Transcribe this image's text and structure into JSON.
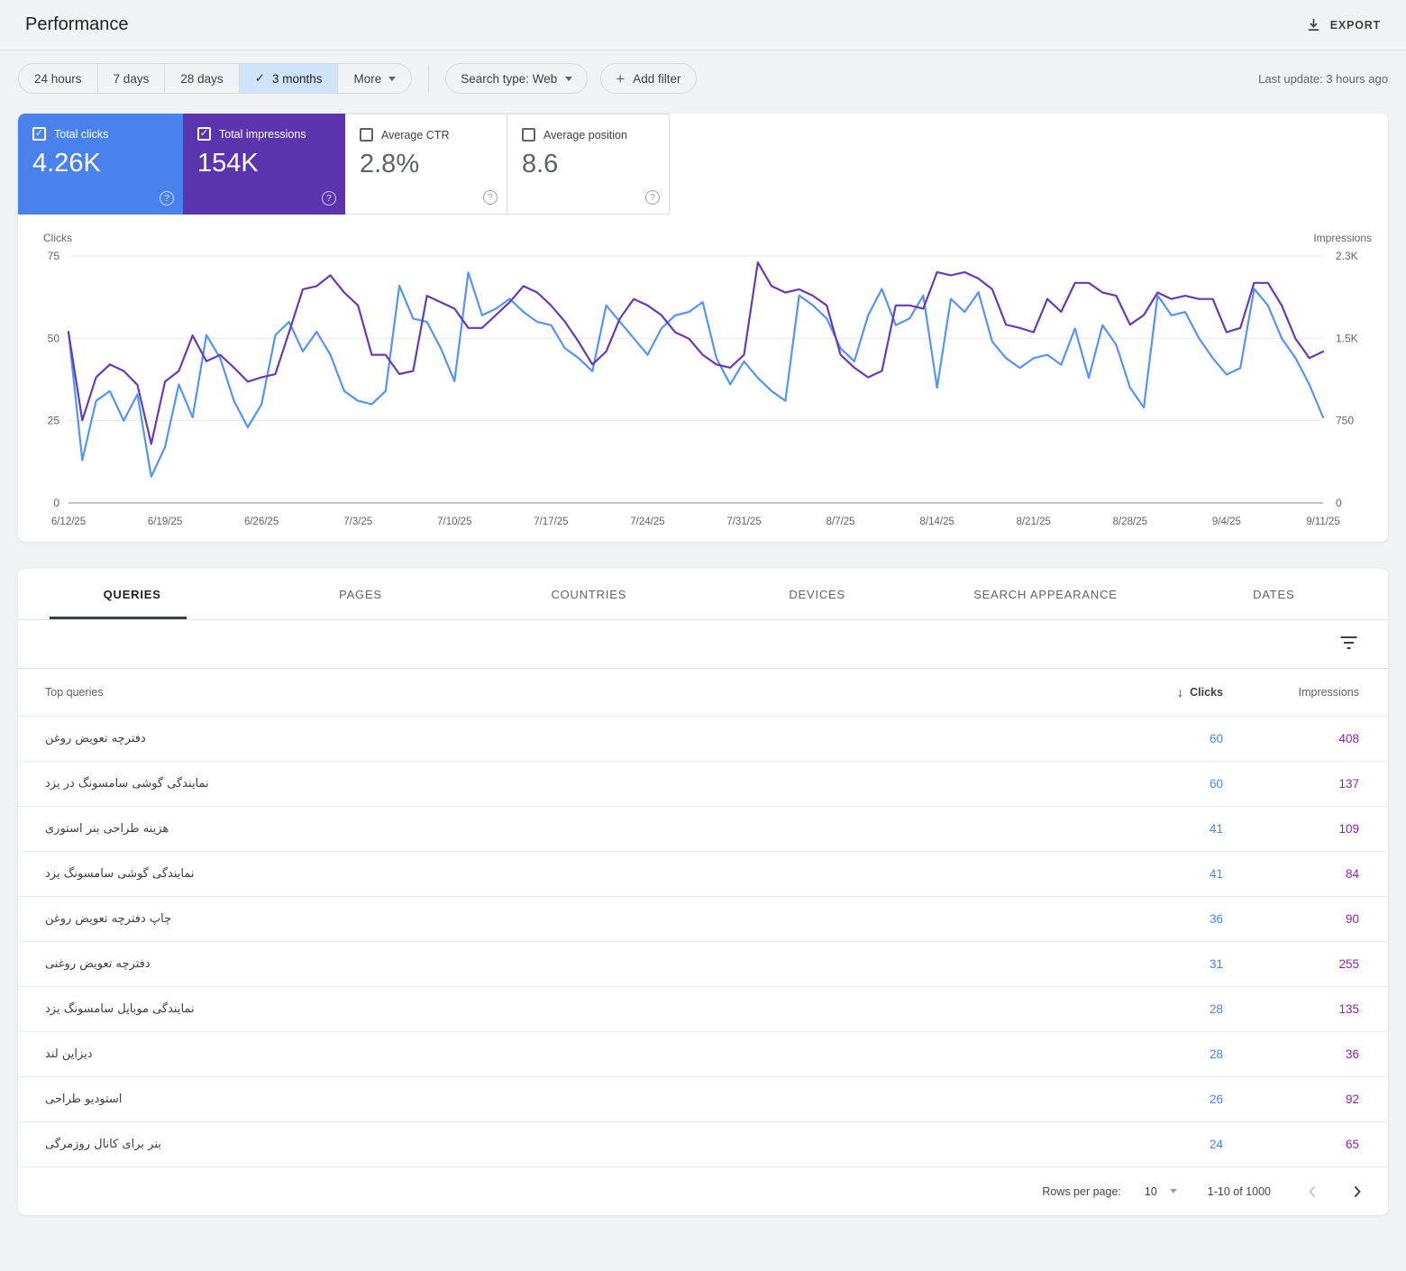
{
  "header": {
    "title": "Performance",
    "export_label": "EXPORT"
  },
  "filters": {
    "ranges": [
      {
        "label": "24 hours",
        "selected": false
      },
      {
        "label": "7 days",
        "selected": false
      },
      {
        "label": "28 days",
        "selected": false
      },
      {
        "label": "3 months",
        "selected": true
      },
      {
        "label": "More",
        "selected": false
      }
    ],
    "search_type_label": "Search type: Web",
    "add_filter_label": "Add filter",
    "last_update": "Last update: 3 hours ago"
  },
  "metrics": [
    {
      "label": "Total clicks",
      "value": "4.26K",
      "checked": true,
      "color": "#4a82ed"
    },
    {
      "label": "Total impressions",
      "value": "154K",
      "checked": true,
      "color": "#5b35b0"
    },
    {
      "label": "Average CTR",
      "value": "2.8%",
      "checked": false,
      "color": "#ffffff"
    },
    {
      "label": "Average position",
      "value": "8.6",
      "checked": false,
      "color": "#ffffff"
    }
  ],
  "chart_data": {
    "type": "line",
    "title": "",
    "grid": true,
    "legend_position": "none",
    "num_points": 92,
    "x_tick_labels": [
      "6/12/25",
      "6/19/25",
      "6/26/25",
      "7/3/25",
      "7/10/25",
      "7/17/25",
      "7/24/25",
      "7/31/25",
      "8/7/25",
      "8/14/25",
      "8/21/25",
      "8/28/25",
      "9/4/25",
      "9/11/25"
    ],
    "tick_day_indices": [
      0,
      7,
      14,
      21,
      28,
      35,
      42,
      49,
      56,
      63,
      70,
      77,
      84,
      91
    ],
    "left_axis": {
      "title": "Clicks",
      "max": 75,
      "ticks": [
        75,
        50,
        25,
        0
      ],
      "tick_labels": [
        "75",
        "50",
        "25",
        "0"
      ]
    },
    "right_axis": {
      "title": "Impressions",
      "max": 2300,
      "ticks": [
        2300,
        1500,
        750,
        0
      ],
      "tick_labels": [
        "2.3K",
        "1.5K",
        "750",
        "0"
      ]
    },
    "series": [
      {
        "name": "Clicks",
        "axis": "left",
        "color": "#5494f6",
        "values": [
          52,
          13,
          31,
          34,
          25,
          33,
          8,
          17,
          36,
          26,
          51,
          44,
          31,
          23,
          30,
          51,
          55,
          46,
          52,
          45,
          34,
          31,
          30,
          34,
          66,
          56,
          55,
          47,
          37,
          70,
          57,
          59,
          62,
          58,
          55,
          54,
          47,
          44,
          40,
          60,
          55,
          50,
          45,
          53,
          57,
          58,
          61,
          44,
          36,
          43,
          38,
          34,
          31,
          63,
          60,
          56,
          47,
          43,
          57,
          65,
          54,
          56,
          63,
          35,
          62,
          58,
          64,
          49,
          44,
          41,
          44,
          45,
          42,
          53,
          38,
          54,
          48,
          35,
          29,
          63,
          57,
          58,
          50,
          44,
          39,
          41,
          65,
          60,
          50,
          44,
          36,
          26
        ]
      },
      {
        "name": "Impressions",
        "axis": "right",
        "color": "#673ab7",
        "values": [
          1590,
          770,
          1170,
          1290,
          1230,
          1100,
          550,
          1130,
          1230,
          1560,
          1320,
          1380,
          1260,
          1130,
          1170,
          1200,
          1590,
          1990,
          2020,
          2120,
          1960,
          1840,
          1380,
          1380,
          1200,
          1230,
          1930,
          1870,
          1810,
          1630,
          1630,
          1750,
          1870,
          2020,
          1960,
          1840,
          1690,
          1500,
          1290,
          1410,
          1720,
          1900,
          1840,
          1750,
          1590,
          1530,
          1380,
          1290,
          1260,
          1380,
          2240,
          2020,
          1960,
          1990,
          1930,
          1840,
          1380,
          1260,
          1170,
          1230,
          1840,
          1840,
          1810,
          2150,
          2120,
          2150,
          2090,
          1990,
          1660,
          1630,
          1590,
          1900,
          1780,
          2050,
          2050,
          1960,
          1930,
          1660,
          1750,
          1960,
          1900,
          1930,
          1900,
          1900,
          1590,
          1630,
          2050,
          2050,
          1840,
          1530,
          1350,
          1410
        ]
      }
    ]
  },
  "tabs": [
    {
      "label": "QUERIES",
      "active": true
    },
    {
      "label": "PAGES",
      "active": false
    },
    {
      "label": "COUNTRIES",
      "active": false
    },
    {
      "label": "DEVICES",
      "active": false
    },
    {
      "label": "SEARCH APPEARANCE",
      "active": false
    },
    {
      "label": "DATES",
      "active": false
    }
  ],
  "table": {
    "col_query": "Top queries",
    "col_clicks": "Clicks",
    "col_impressions": "Impressions",
    "rows": [
      {
        "query": "دفترچه تعویض روغن",
        "clicks": 60,
        "impressions": 408
      },
      {
        "query": "نمایندگی گوشی سامسونگ در یزد",
        "clicks": 60,
        "impressions": 137
      },
      {
        "query": "هزینه طراحی بنر استوری",
        "clicks": 41,
        "impressions": 109
      },
      {
        "query": "نمایندگی گوشی سامسونگ یزد",
        "clicks": 41,
        "impressions": 84
      },
      {
        "query": "چاپ دفترچه تعویض روغن",
        "clicks": 36,
        "impressions": 90
      },
      {
        "query": "دفترچه تعویض روغنی",
        "clicks": 31,
        "impressions": 255
      },
      {
        "query": "نمایندگی موبایل سامسونگ یزد",
        "clicks": 28,
        "impressions": 135
      },
      {
        "query": "دیزاین لند",
        "clicks": 28,
        "impressions": 36
      },
      {
        "query": "استودیو طراحی",
        "clicks": 26,
        "impressions": 92
      },
      {
        "query": "بنر برای کانال روزمرگی",
        "clicks": 24,
        "impressions": 65
      }
    ]
  },
  "pagination": {
    "rows_per_page_label": "Rows per page:",
    "rows_per_page": "10",
    "range": "1-10 of 1000"
  }
}
